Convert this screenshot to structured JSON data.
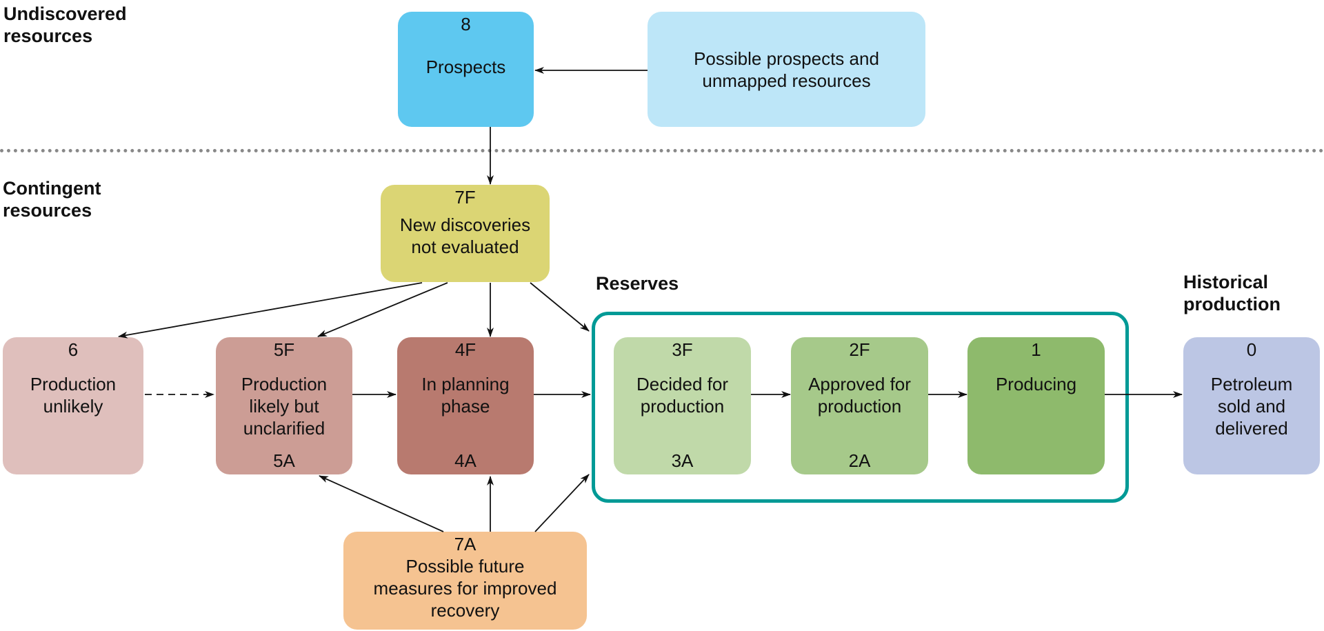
{
  "sections": {
    "undiscovered": "Undiscovered\nresources",
    "contingent": "Contingent\nresources",
    "reserves": "Reserves",
    "historical": "Historical\nproduction"
  },
  "boxes": {
    "b8": {
      "code": "8",
      "text": "Prospects",
      "color": "#5ec8f0"
    },
    "possible": {
      "text": "Possible prospects and\nunmapped resources",
      "color": "#bde6f8"
    },
    "b7f": {
      "code": "7F",
      "text": "New discoveries\nnot evaluated",
      "color": "#dbd574"
    },
    "b6": {
      "code": "6",
      "text": "Production\nunlikely",
      "color": "#dfbfbc"
    },
    "b5": {
      "code": "5F",
      "code2": "5A",
      "text": "Production\nlikely but\nunclarified",
      "color": "#cc9d95"
    },
    "b4": {
      "code": "4F",
      "code2": "4A",
      "text": "In planning\nphase",
      "color": "#b87a6f"
    },
    "b3": {
      "code": "3F",
      "code2": "3A",
      "text": "Decided for\nproduction",
      "color": "#c0d9a9"
    },
    "b2": {
      "code": "2F",
      "code2": "2A",
      "text": "Approved for\nproduction",
      "color": "#a6c98a"
    },
    "b1": {
      "code": "1",
      "text": "Producing",
      "color": "#8eba6c"
    },
    "b0": {
      "code": "0",
      "text": "Petroleum\nsold and\ndelivered",
      "color": "#bcc6e4"
    },
    "b7a": {
      "code": "7A",
      "text": "Possible future\nmeasures for improved\nrecovery",
      "color": "#f5c391"
    }
  },
  "reserves_frame_color": "#009a96"
}
